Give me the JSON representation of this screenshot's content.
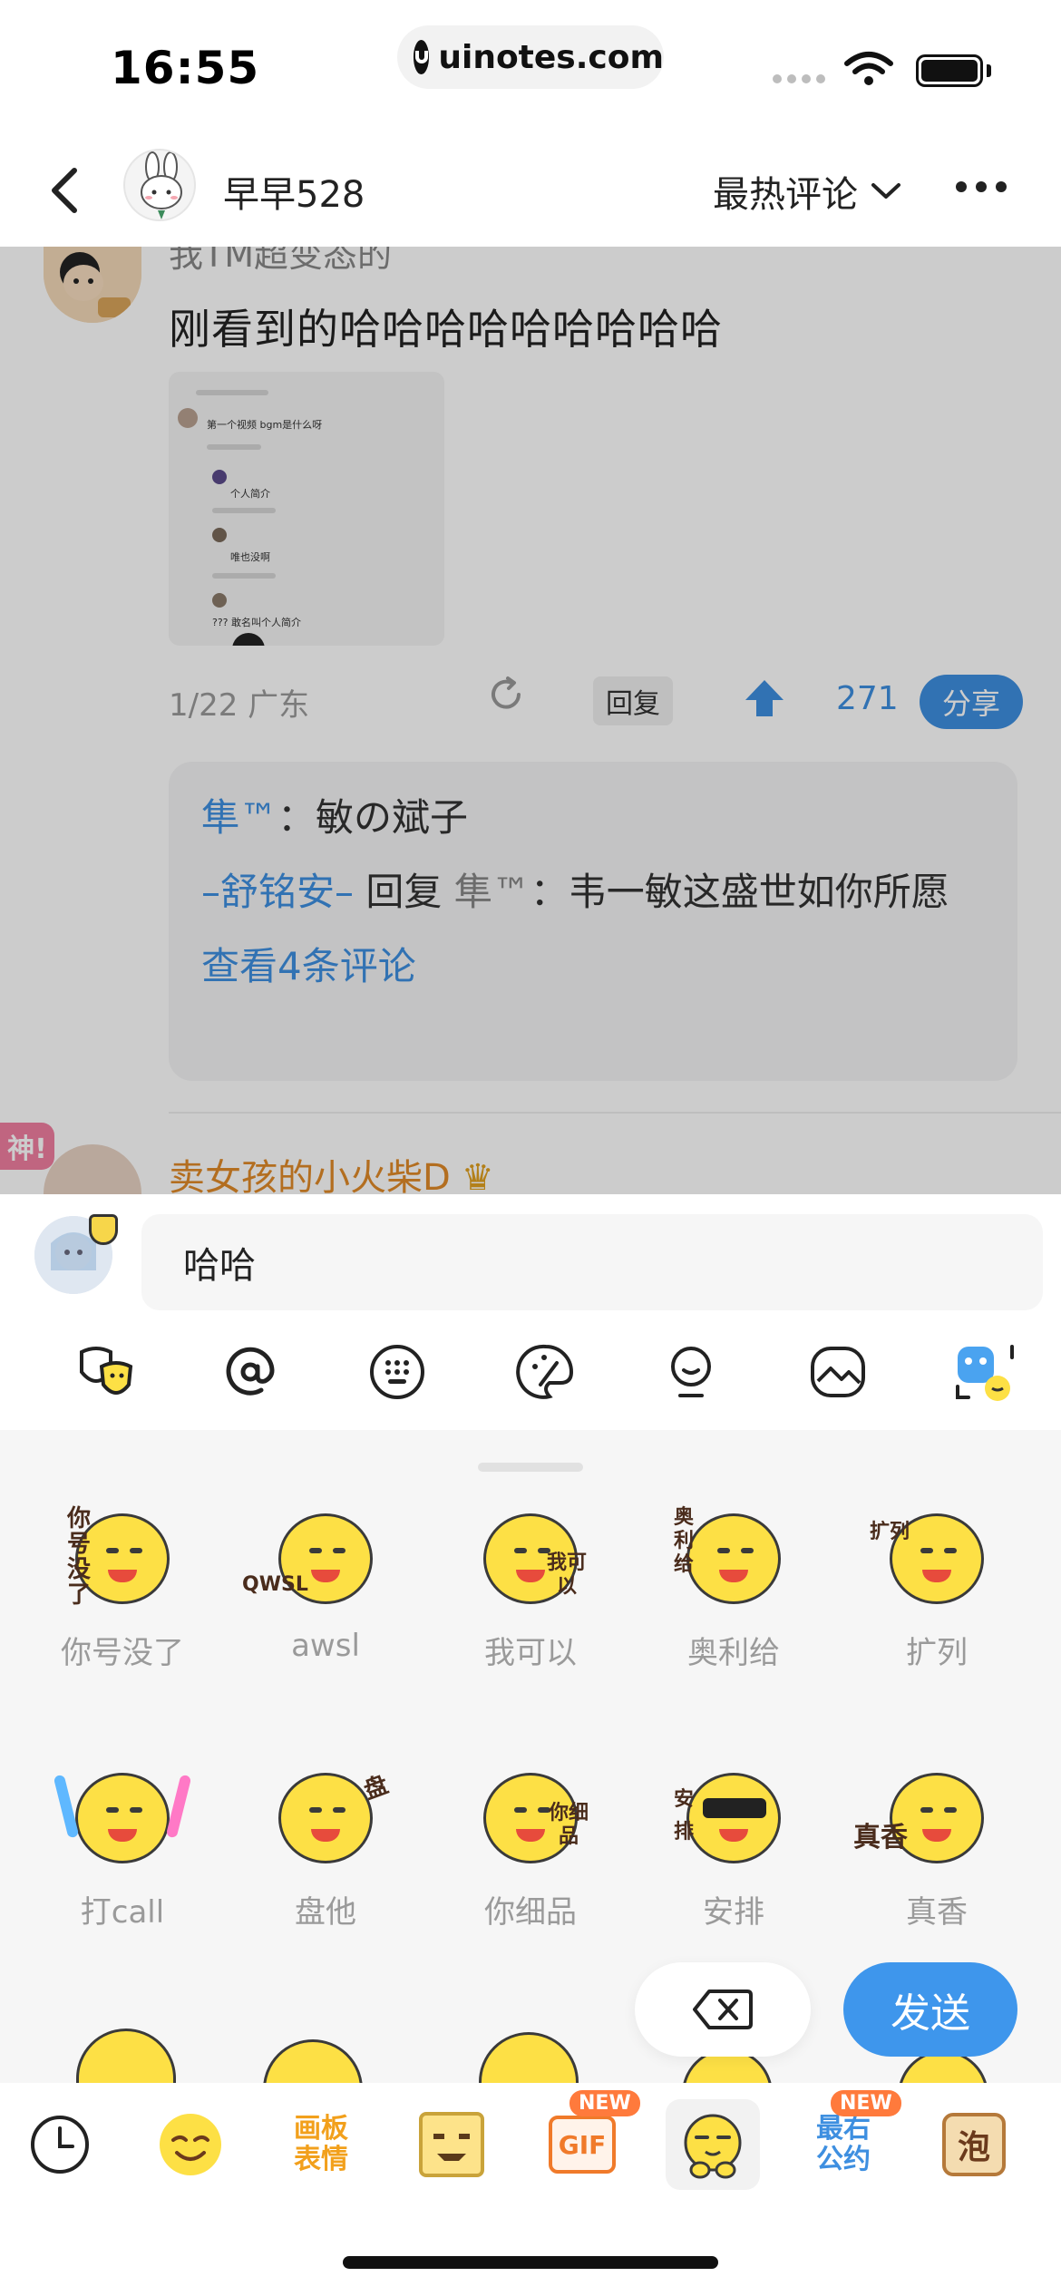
{
  "status_bar": {
    "time": "16:55",
    "url": "uinotes.com"
  },
  "header": {
    "title": "早早528",
    "sort_label": "最热评论"
  },
  "comment": {
    "author_partial": "我TM超变态的",
    "text": "刚看到的哈哈哈哈哈哈哈哈哈",
    "meta": "1/22  广东",
    "reply_label": "回复",
    "like_count": "271",
    "share_label": "分享",
    "thumb_lines": [
      "第一个视频 bgm是什么呀",
      "个人简介",
      "唯也没啊",
      "??? 敢名叫个人简介"
    ]
  },
  "replies": {
    "r1_name": "隼™",
    "r1_text": "敏の斌子",
    "r2_name": "–舒铭安–",
    "r2_reply": "回复",
    "r2_target": "隼™",
    "r2_text": "韦一敏这盛世如你所愿",
    "view_more": "查看4条评论"
  },
  "next_comment": {
    "badge": "神!",
    "name": "卖女孩的小火柴D",
    "crown": "♛"
  },
  "composer": {
    "input_value": "哈哈"
  },
  "stickers": [
    {
      "label": "你号没了",
      "tag": "你号没了"
    },
    {
      "label": "awsl",
      "tag": "QWSL"
    },
    {
      "label": "我可以",
      "tag": "我可以"
    },
    {
      "label": "奥利给",
      "tag": "奥利给"
    },
    {
      "label": "扩列",
      "tag": "扩列"
    },
    {
      "label": "打call",
      "tag": ""
    },
    {
      "label": "盘他",
      "tag": "盘"
    },
    {
      "label": "你细品",
      "tag": "你细品"
    },
    {
      "label": "安排",
      "tag": "安排"
    },
    {
      "label": "真香",
      "tag": "真香"
    }
  ],
  "actions": {
    "send_label": "发送"
  },
  "tabs": [
    {
      "icon": "clock-icon",
      "text": ""
    },
    {
      "icon": "smile-face-icon",
      "text": ""
    },
    {
      "icon": "canvas-sticker-icon",
      "text": "画板表情"
    },
    {
      "icon": "pixel-face-icon",
      "text": ""
    },
    {
      "icon": "gif-icon",
      "text": "GIF",
      "badge": "NEW"
    },
    {
      "icon": "sticker-face-icon",
      "text": ""
    },
    {
      "icon": "friend-pact-icon",
      "text": "最右公约",
      "badge": "NEW"
    },
    {
      "icon": "bubble-icon",
      "text": "泡"
    }
  ],
  "colors": {
    "accent": "#3e8fe0",
    "sticker_yellow": "#fde045",
    "username_orange": "#e08a28"
  }
}
